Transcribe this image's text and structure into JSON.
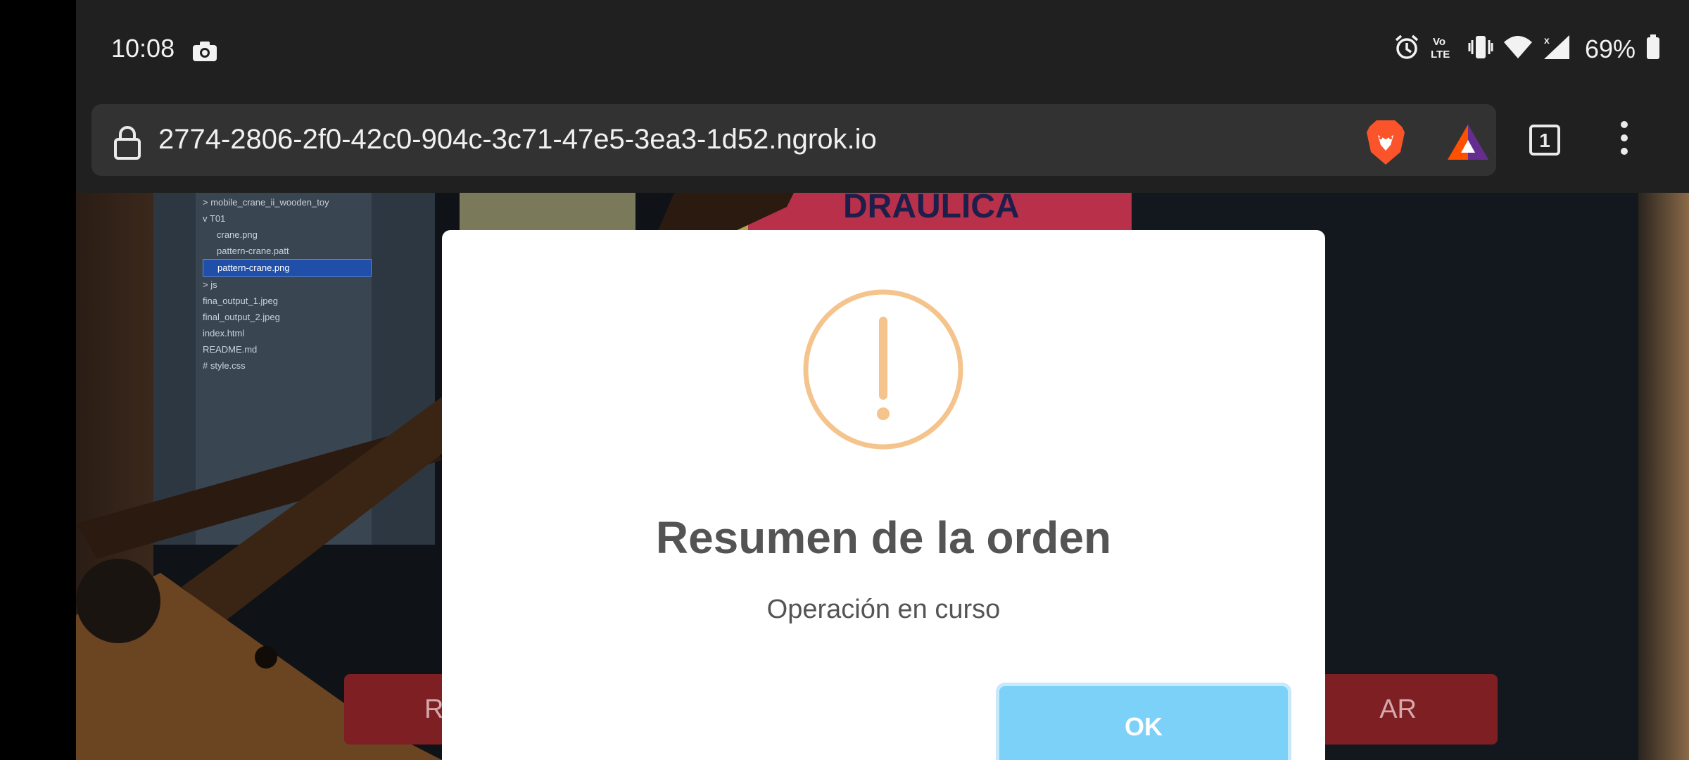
{
  "status_bar": {
    "time": "10:08",
    "battery": "69%",
    "icons": [
      "camera-icon",
      "alarm-icon",
      "volte-icon",
      "vibrate-icon",
      "wifi-icon",
      "signal-icon",
      "battery-icon"
    ]
  },
  "browser": {
    "url": "2774-2806-2f0-42c0-904c-3c71-47e5-3ea3-1d52.ngrok.io",
    "tab_count": "1",
    "icons": [
      "lock-icon",
      "brave-lion-icon",
      "bat-rewards-icon",
      "tabs-icon",
      "more-vert-icon"
    ]
  },
  "background": {
    "file_tree": [
      "> mobile_crane_ii_wooden_toy",
      "v T01",
      "crane.png",
      "pattern-crane.patt",
      "pattern-crane.png",
      "> js",
      "fina_output_1.jpeg",
      "final_output_2.jpeg",
      "index.html",
      "README.md",
      "# style.css"
    ],
    "sign_text": "DRAULICA",
    "left_button_partial": "RI",
    "right_button_partial": "AR"
  },
  "modal": {
    "icon": "warning-icon",
    "title": "Resumen de la orden",
    "text": "Operación en curso",
    "ok_label": "OK"
  },
  "colors": {
    "warning": "#f5c38c",
    "ok_button": "#7cd1f9",
    "bg_button": "#7e1f24"
  }
}
